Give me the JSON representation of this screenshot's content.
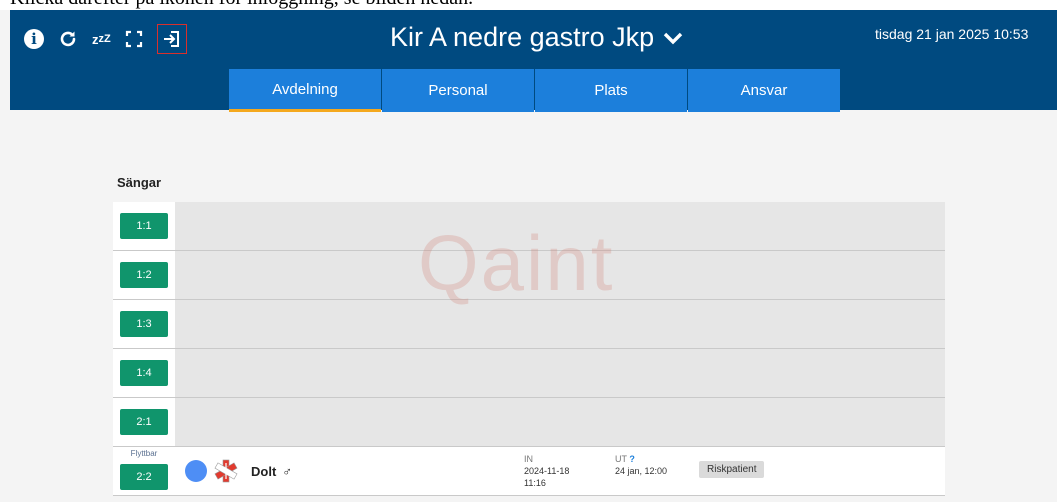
{
  "caption": "Klicka därefter på ikonen för inloggning, se bilden nedan.",
  "header": {
    "title": "Kir A nedre gastro Jkp",
    "datetime": "tisdag 21 jan 2025 10:53",
    "icons": [
      "info-icon",
      "refresh-icon",
      "sleep-icon",
      "fullscreen-icon",
      "login-icon"
    ],
    "sleep_glyph": "z",
    "sleep_glyph_sup": "zZ"
  },
  "tabs": [
    "Avdelning",
    "Personal",
    "Plats",
    "Ansvar"
  ],
  "active_tab": "Avdelning",
  "section": {
    "title": "Sängar"
  },
  "watermark": "Qaint",
  "beds": [
    {
      "id": "1:1"
    },
    {
      "id": "1:2"
    },
    {
      "id": "1:3"
    },
    {
      "id": "1:4"
    },
    {
      "id": "2:1"
    },
    {
      "id": "2:2",
      "tag": "Flyttbar",
      "patient": {
        "name": "Dolt",
        "gender_symbol": "♂",
        "in_label": "IN",
        "in_date": "2024-11-18",
        "in_time": "11:16",
        "ut_label": "UT",
        "ut_question": "?",
        "ut_value": "24 jan, 12:00",
        "badge": "Riskpatient"
      }
    }
  ],
  "colors": {
    "header_bg": "#004a80",
    "tab_bg": "#1c7fdb",
    "tab_active_underline": "#f4a81d",
    "bed_green": "#10956c",
    "highlight_red": "#d9302c"
  }
}
